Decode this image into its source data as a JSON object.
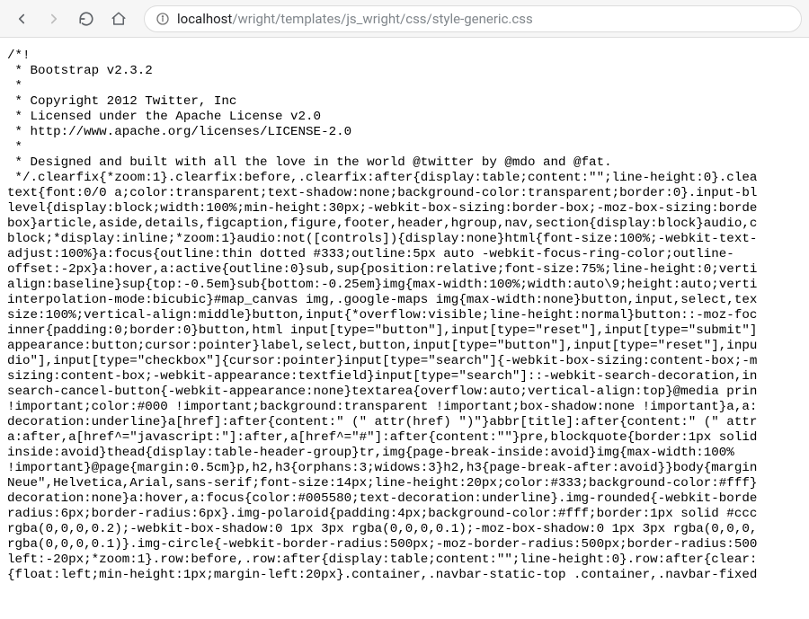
{
  "toolbar": {
    "back_title": "Back",
    "forward_title": "Forward",
    "reload_title": "Reload",
    "home_title": "Home"
  },
  "url": {
    "host": "localhost",
    "path": "/wright/templates/js_wright/css/style-generic.css"
  },
  "file": {
    "lines": [
      "/*!",
      " * Bootstrap v2.3.2",
      " *",
      " * Copyright 2012 Twitter, Inc",
      " * Licensed under the Apache License v2.0",
      " * http://www.apache.org/licenses/LICENSE-2.0",
      " *",
      " * Designed and built with all the love in the world @twitter by @mdo and @fat.",
      " */.clearfix{*zoom:1}.clearfix:before,.clearfix:after{display:table;content:\"\";line-height:0}.clea",
      "text{font:0/0 a;color:transparent;text-shadow:none;background-color:transparent;border:0}.input-bl",
      "level{display:block;width:100%;min-height:30px;-webkit-box-sizing:border-box;-moz-box-sizing:borde",
      "box}article,aside,details,figcaption,figure,footer,header,hgroup,nav,section{display:block}audio,c",
      "block;*display:inline;*zoom:1}audio:not([controls]){display:none}html{font-size:100%;-webkit-text-",
      "adjust:100%}a:focus{outline:thin dotted #333;outline:5px auto -webkit-focus-ring-color;outline-",
      "offset:-2px}a:hover,a:active{outline:0}sub,sup{position:relative;font-size:75%;line-height:0;verti",
      "align:baseline}sup{top:-0.5em}sub{bottom:-0.25em}img{max-width:100%;width:auto\\9;height:auto;verti",
      "interpolation-mode:bicubic}#map_canvas img,.google-maps img{max-width:none}button,input,select,tex",
      "size:100%;vertical-align:middle}button,input{*overflow:visible;line-height:normal}button::-moz-foc",
      "inner{padding:0;border:0}button,html input[type=\"button\"],input[type=\"reset\"],input[type=\"submit\"]",
      "appearance:button;cursor:pointer}label,select,button,input[type=\"button\"],input[type=\"reset\"],inpu",
      "dio\"],input[type=\"checkbox\"]{cursor:pointer}input[type=\"search\"]{-webkit-box-sizing:content-box;-m",
      "sizing:content-box;-webkit-appearance:textfield}input[type=\"search\"]::-webkit-search-decoration,in",
      "search-cancel-button{-webkit-appearance:none}textarea{overflow:auto;vertical-align:top}@media prin",
      "!important;color:#000 !important;background:transparent !important;box-shadow:none !important}a,a:",
      "decoration:underline}a[href]:after{content:\" (\" attr(href) \")\"}abbr[title]:after{content:\" (\" attr",
      "a:after,a[href^=\"javascript:\"]:after,a[href^=\"#\"]:after{content:\"\"}pre,blockquote{border:1px solid ",
      "inside:avoid}thead{display:table-header-group}tr,img{page-break-inside:avoid}img{max-width:100% ",
      "!important}@page{margin:0.5cm}p,h2,h3{orphans:3;widows:3}h2,h3{page-break-after:avoid}}body{margin",
      "Neue\",Helvetica,Arial,sans-serif;font-size:14px;line-height:20px;color:#333;background-color:#fff}",
      "decoration:none}a:hover,a:focus{color:#005580;text-decoration:underline}.img-rounded{-webkit-borde",
      "radius:6px;border-radius:6px}.img-polaroid{padding:4px;background-color:#fff;border:1px solid #ccc",
      "rgba(0,0,0,0.2);-webkit-box-shadow:0 1px 3px rgba(0,0,0,0.1);-moz-box-shadow:0 1px 3px rgba(0,0,0,",
      "rgba(0,0,0,0.1)}.img-circle{-webkit-border-radius:500px;-moz-border-radius:500px;border-radius:500",
      "left:-20px;*zoom:1}.row:before,.row:after{display:table;content:\"\";line-height:0}.row:after{clear:",
      "{float:left;min-height:1px;margin-left:20px}.container,.navbar-static-top .container,.navbar-fixed"
    ]
  }
}
